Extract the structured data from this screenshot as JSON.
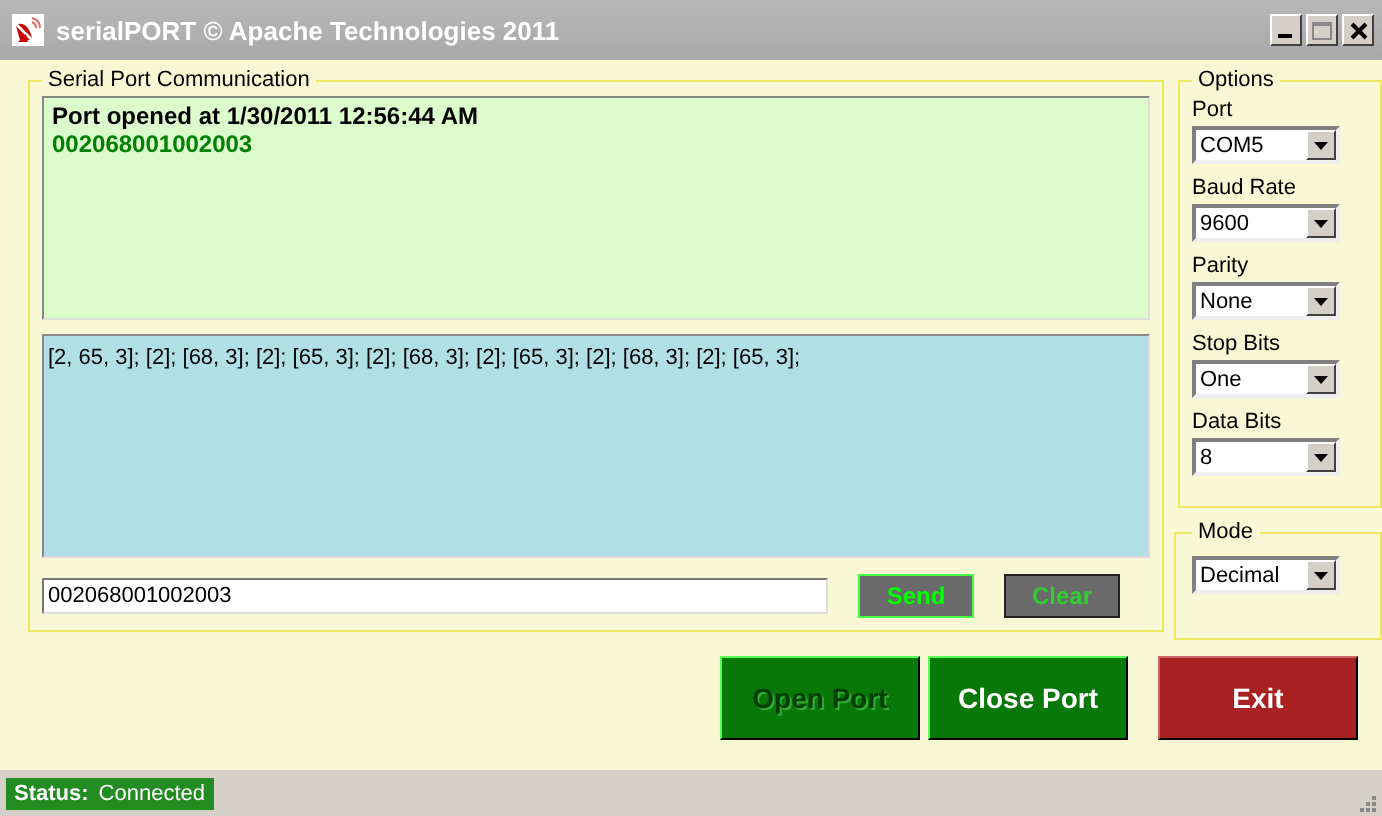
{
  "window": {
    "title": "serialPORT © Apache Technologies 2011"
  },
  "communication": {
    "title": "Serial Port Communication",
    "log_heading": "Port opened at 1/30/2011 12:56:44 AM",
    "log_data": "002068001002003",
    "received": "[2, 65, 3]; [2]; [68, 3]; [2]; [65, 3]; [2]; [68, 3]; [2]; [65, 3]; [2]; [68, 3]; [2]; [65, 3];",
    "input": "002068001002003",
    "send": {
      "label": "Send",
      "disabled": false
    },
    "clear": {
      "label": "Clear",
      "disabled": true
    }
  },
  "options": {
    "title": "Options",
    "fields": [
      {
        "label": "Port",
        "value": "COM5"
      },
      {
        "label": "Baud Rate",
        "value": "9600"
      },
      {
        "label": "Parity",
        "value": "None"
      },
      {
        "label": "Stop Bits",
        "value": "One"
      },
      {
        "label": "Data Bits",
        "value": "8"
      }
    ]
  },
  "mode": {
    "title": "Mode",
    "value": "Decimal"
  },
  "buttons": [
    {
      "label": "Open Port",
      "kind": "open",
      "disabled": true
    },
    {
      "label": "Close Port",
      "kind": "close",
      "disabled": false
    },
    {
      "label": "Exit",
      "kind": "exit",
      "disabled": false
    }
  ],
  "status_bar": {
    "label": "Status:",
    "value": "Connected"
  }
}
